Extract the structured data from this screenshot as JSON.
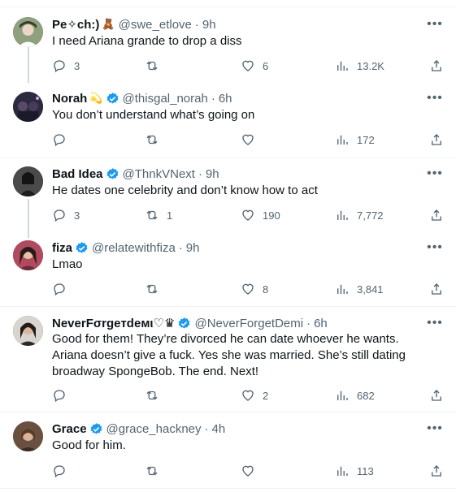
{
  "colors": {
    "accent": "#1d9bf0",
    "text": "#0f1419",
    "muted": "#536471",
    "divider": "#eff3f4",
    "thread": "#cfd9de"
  },
  "tweets": [
    {
      "name": "Pe✧ch:)",
      "emoji": "🧸",
      "verified": false,
      "handle": "@swe_etlove",
      "dot": "·",
      "time": "9h",
      "text": "I need Ariana grande to drop a diss",
      "replies": "3",
      "retweets": "",
      "likes": "6",
      "views": "13.2K",
      "avatar_color": "#6b7f5e"
    },
    {
      "name": "Norah",
      "emoji": "💫",
      "verified": true,
      "handle": "@thisgal_norah",
      "dot": "·",
      "time": "6h",
      "text": "You don’t understand what’s going on",
      "replies": "",
      "retweets": "",
      "likes": "",
      "views": "172",
      "avatar_color": "#2c2a3a"
    },
    {
      "name": "Bad Idea",
      "emoji": "",
      "verified": true,
      "handle": "@ThnkVNext",
      "dot": "·",
      "time": "9h",
      "text": "He dates one celebrity and don’t know how to act",
      "replies": "3",
      "retweets": "1",
      "likes": "190",
      "views": "7,772",
      "avatar_color": "#3b3b3b"
    },
    {
      "name": "fiza",
      "emoji": "",
      "verified": true,
      "handle": "@relatewithfiza",
      "dot": "·",
      "time": "9h",
      "text": "Lmao",
      "replies": "",
      "retweets": "",
      "likes": "8",
      "views": "3,841",
      "avatar_color": "#8a3a4a"
    },
    {
      "name": "NeverFσrgeтdeмι♡♛",
      "emoji": "",
      "verified": true,
      "handle": "@NeverForgetDemi",
      "dot": "·",
      "time": "6h",
      "text": "Good for them! They’re divorced he can date whoever he wants. Ariana doesn’t give a fuck. Yes she was married. She’s still dating broadway SpongeBob. The end. Next!",
      "replies": "",
      "retweets": "",
      "likes": "2",
      "views": "682",
      "avatar_color": "#5a4a42"
    },
    {
      "name": "Grace",
      "emoji": "",
      "verified": true,
      "handle": "@grace_hackney",
      "dot": "·",
      "time": "4h",
      "text": "Good for him.",
      "replies": "",
      "retweets": "",
      "likes": "",
      "views": "113",
      "avatar_color": "#7a5c48"
    }
  ],
  "icons": {
    "reply": "reply-icon",
    "retweet": "retweet-icon",
    "like": "heart-icon",
    "views": "views-icon",
    "share": "share-icon",
    "more": "more-icon",
    "verified": "verified-badge-icon"
  },
  "more_glyph": "•••"
}
